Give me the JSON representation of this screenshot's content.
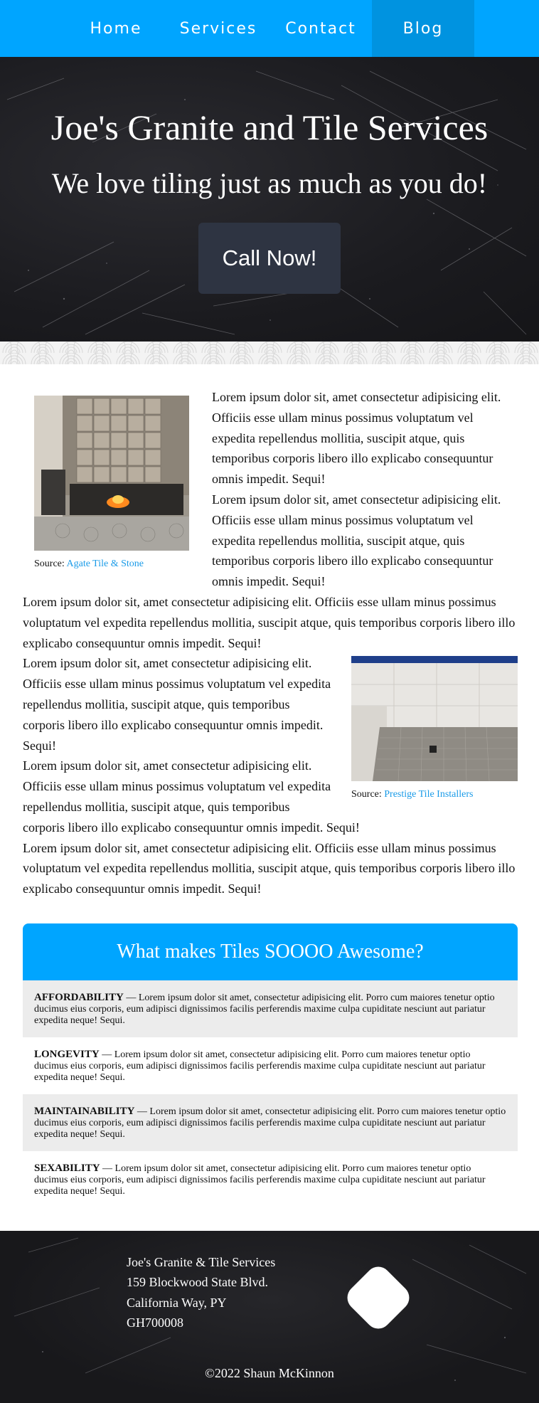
{
  "nav": {
    "items": [
      "Home",
      "Services",
      "Contact",
      "Blog"
    ]
  },
  "hero": {
    "title": "Joe's Granite and Tile Services",
    "subtitle": "We love tiling just as much as you do!",
    "cta_label": "Call Now!"
  },
  "article": {
    "paragraph": "Lorem ipsum dolor sit, amet consectetur adipisicing elit. Officiis esse ullam minus possimus voluptatum vel expedita repellendus mollitia, suscipit atque, quis temporibus corporis libero illo explicabo consequuntur omnis impedit. Sequi!",
    "figure_left": {
      "source_label": "Source:",
      "source_link": "Agate Tile & Stone"
    },
    "figure_right": {
      "source_label": "Source:",
      "source_link": "Prestige Tile Installers"
    }
  },
  "features": {
    "heading": "What makes Tiles SOOOO Awesome?",
    "items": [
      {
        "title": "AFFORDABILITY",
        "text": " — Lorem ipsum dolor sit amet, consectetur adipisicing elit. Porro cum maiores tenetur optio ducimus eius corporis, eum adipisci dignissimos facilis perferendis maxime culpa cupiditate nesciunt aut pariatur expedita neque! Sequi."
      },
      {
        "title": "LONGEVITY",
        "text": " — Lorem ipsum dolor sit amet, consectetur adipisicing elit. Porro cum maiores tenetur optio ducimus eius corporis, eum adipisci dignissimos facilis perferendis maxime culpa cupiditate nesciunt aut pariatur expedita neque! Sequi."
      },
      {
        "title": "MAINTAINABILITY",
        "text": " — Lorem ipsum dolor sit amet, consectetur adipisicing elit. Porro cum maiores tenetur optio ducimus eius corporis, eum adipisci dignissimos facilis perferendis maxime culpa cupiditate nesciunt aut pariatur expedita neque! Sequi."
      },
      {
        "title": "SEXABILITY",
        "text": " — Lorem ipsum dolor sit amet, consectetur adipisicing elit. Porro cum maiores tenetur optio ducimus eius corporis, eum adipisci dignissimos facilis perferendis maxime culpa cupiditate nesciunt aut pariatur expedita neque! Sequi."
      }
    ]
  },
  "footer": {
    "address": [
      "Joe's Granite & Tile Services",
      "159 Blockwood State Blvd.",
      "California Way, PY",
      "GH700008"
    ],
    "copyright": "©2022 Shaun McKinnon"
  },
  "colors": {
    "accent": "#00a5ff",
    "nav_active": "#0093e0",
    "cta": "#2e3442",
    "link": "#1a9be8",
    "stripe": "#ececec"
  }
}
